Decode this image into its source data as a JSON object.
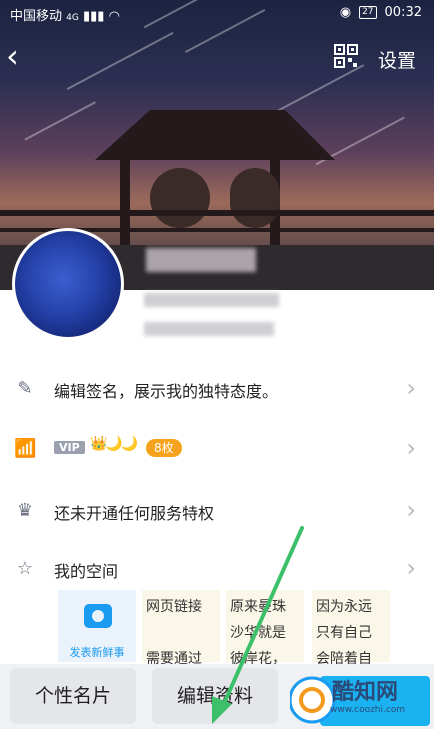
{
  "status_bar": {
    "carrier": "中国移动",
    "network": "4G",
    "battery": "27",
    "time": "00:32"
  },
  "header": {
    "back_label": "‹",
    "settings_label": "设置"
  },
  "rows": [
    {
      "label": "编辑签名，展示我的独特态度。"
    },
    {
      "vip_label": "VIP",
      "crown_icons": "👑🌙🌙",
      "badge_label": "8枚"
    },
    {
      "label": "还未开通任何服务特权"
    },
    {
      "label": "我的空间"
    }
  ],
  "space": {
    "camera_label": "发表新鲜事",
    "previews": [
      "网页链接\n\n需要通过",
      "原来曼珠\n沙华就是\n彼岸花，",
      "因为永远\n只有自己\n会陪着自"
    ]
  },
  "bottom": {
    "card_label": "个性名片",
    "edit_label": "编辑资料"
  },
  "watermark": {
    "name": "酷知网",
    "url": "www.coozhi.com"
  },
  "colors": {
    "accent": "#1a9bf0",
    "arrow": "#3cc06a",
    "badge": "#f7a21b"
  }
}
